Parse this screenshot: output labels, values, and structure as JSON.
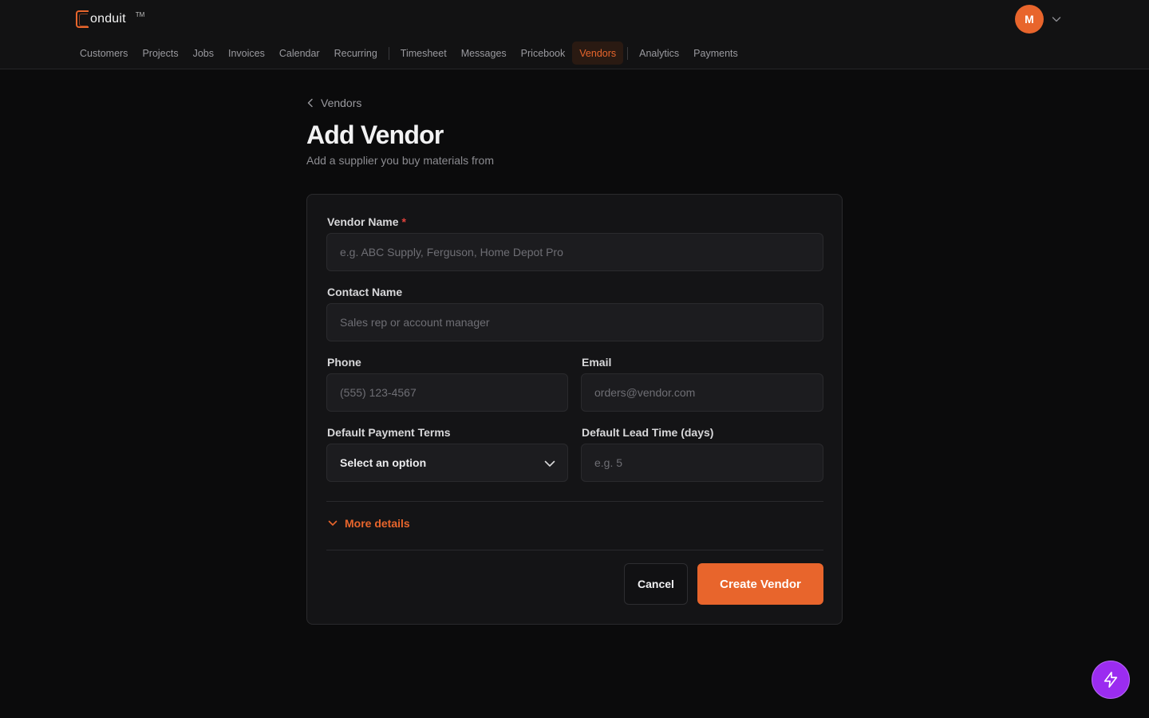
{
  "brand": {
    "name": "onduit",
    "tm": "TM"
  },
  "user": {
    "initial": "M"
  },
  "nav": {
    "items": [
      {
        "label": "Customers"
      },
      {
        "label": "Projects"
      },
      {
        "label": "Jobs"
      },
      {
        "label": "Invoices"
      },
      {
        "label": "Calendar"
      },
      {
        "label": "Recurring"
      },
      {
        "label": "Timesheet"
      },
      {
        "label": "Messages"
      },
      {
        "label": "Pricebook"
      },
      {
        "label": "Vendors",
        "active": true
      },
      {
        "label": "Analytics"
      },
      {
        "label": "Payments"
      }
    ]
  },
  "breadcrumb": {
    "label": "Vendors"
  },
  "page": {
    "title": "Add Vendor",
    "subtitle": "Add a supplier you buy materials from"
  },
  "form": {
    "vendor_name": {
      "label": "Vendor Name",
      "required_mark": "*",
      "placeholder": "e.g. ABC Supply, Ferguson, Home Depot Pro",
      "value": ""
    },
    "contact_name": {
      "label": "Contact Name",
      "placeholder": "Sales rep or account manager",
      "value": ""
    },
    "phone": {
      "label": "Phone",
      "placeholder": "(555) 123-4567",
      "value": ""
    },
    "email": {
      "label": "Email",
      "placeholder": "orders@vendor.com",
      "value": ""
    },
    "payment_terms": {
      "label": "Default Payment Terms",
      "selected": "Select an option"
    },
    "lead_time": {
      "label": "Default Lead Time (days)",
      "placeholder": "e.g. 5",
      "value": ""
    },
    "more_details": "More details",
    "cancel_label": "Cancel",
    "submit_label": "Create Vendor"
  },
  "colors": {
    "accent": "#e8652c",
    "background": "#0b0b0c",
    "card": "#141416",
    "fab": "#9b2cf0",
    "required": "#e2433c"
  },
  "icons": {
    "back": "chevron-left-icon",
    "avatar_menu": "chevron-down-icon",
    "select": "chevron-down-icon",
    "more": "chevron-down-icon",
    "fab": "lightning-icon"
  }
}
